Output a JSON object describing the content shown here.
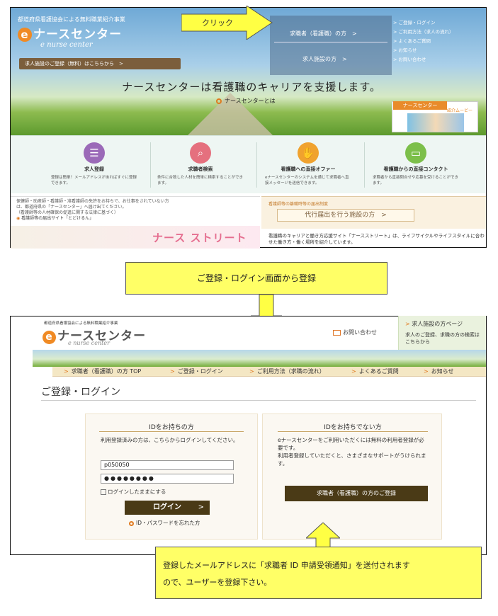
{
  "screenshot1": {
    "association": "都道府県看護協会による無料職業紹介事業",
    "logo_text": "ナースセンター",
    "logo_e": "e",
    "logo_sub": "e nurse center",
    "facility_register_link": "求人施設のご登録（無料）はこちらから　>",
    "nav_seeker": "求職者（看護職）の方　>",
    "nav_facility": "求人施設の方　>",
    "menu": [
      "ご登録・ログイン",
      "ご利用方法（求人の流れ）",
      "よくあるご質問",
      "お知らせ",
      "お問い合わせ"
    ],
    "headline": "ナースセンターは看護職のキャリアを支援します。",
    "subhead": "ナースセンターとは",
    "video_tag": "ナースセンター",
    "video_sub": "紹介ムービー",
    "features": [
      {
        "title": "求人登録",
        "desc": "登録は簡単！メールアドレスがあればすぐに登録できます。",
        "icon": "list-icon",
        "icon_char": "☰",
        "color": "#9b6ab8"
      },
      {
        "title": "求職者検索",
        "desc": "条件に合致した人材を簡単に検索することができます。",
        "icon": "search-person-icon",
        "icon_char": "⌕",
        "color": "#e5707e"
      },
      {
        "title": "看護職への直接オファー",
        "desc": "eナースセンターのシステムを通じて求職者へ直接メッセージを送信できます。",
        "icon": "handshake-icon",
        "icon_char": "✋",
        "color": "#f0a22e"
      },
      {
        "title": "看護職からの直接コンタクト",
        "desc": "求職者から直接問合せや応募を受けることができます。",
        "icon": "id-card-icon",
        "icon_char": "▭",
        "color": "#7cbf4a"
      }
    ],
    "notice": [
      "保健師・助産師・看護師・准看護師の免許をお持ちで、お仕事をされていない方",
      "は、都道府県の「ナースセンター」へ届け出てください。",
      "（看護師等の人材確保の促進に関する法律に基づく）",
      "看護師等の届出サイト「とどけるん」"
    ],
    "system_label": "看護師等の離職時等の届出制度",
    "proxy_button": "代行届出を行う施設の方　>",
    "street_logo": "ナース ストリート",
    "street_text": "看護職のキャリアと働き方応援サイト「ナースストリート」は、ライフサイクルやライフスタイルに合わせた働き方・働く場所を紹介しています。"
  },
  "callouts": {
    "click": "クリック",
    "register_from_login": "ご登録・ログイン画面から登録",
    "email_note_1": "登録したメールアドレスに「求職者 ID 申請受領通知」を送付されます",
    "email_note_2": "ので、ユーザーを登録下さい。"
  },
  "screenshot2": {
    "association": "都道府県看護協会による無料職業紹介事業",
    "logo_text": "ナースセンター",
    "logo_e": "e",
    "logo_sub": "e nurse center",
    "contact": "お問い合わせ",
    "facility_title": "求人施設の方ページ",
    "facility_desc": "求人のご登録、求職の方の検索はこちらから",
    "nav": [
      "求職者（看護職）の方 TOP",
      "ご登録・ログイン",
      "ご利用方法（求職の流れ）",
      "よくあるご質問",
      "お知らせ"
    ],
    "page_title": "ご登録・ログイン",
    "login_panel": {
      "heading": "IDをお持ちの方",
      "desc": "利用登録済みの方は、こちらからログインしてください。",
      "id_value": "p050050",
      "password_mask": "●●●●●●●●",
      "remember": "ログインしたままにする",
      "login_button": "ログイン",
      "forgot": "ID・パスワードを忘れた方"
    },
    "register_panel": {
      "heading": "IDをお持ちでない方",
      "desc_1": "eナースセンターをご利用いただくには無料の利用者登録が必要です。",
      "desc_2": "利用者登録していただくと、さまざまなサポートがうけられます。",
      "register_button": "求職者（看護職）の方のご登録"
    }
  },
  "colors": {
    "accent_orange": "#e07a20",
    "brown_button": "#4a3a16",
    "callout_yellow": "#ffff66"
  }
}
